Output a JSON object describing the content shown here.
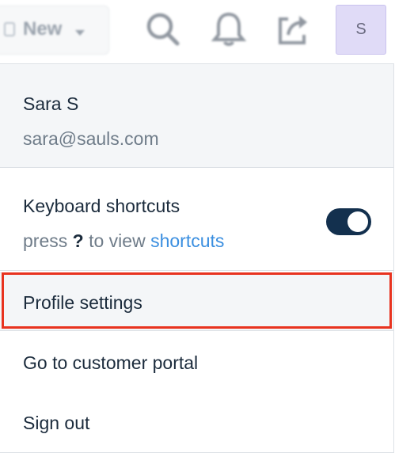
{
  "topbar": {
    "new_label": "New",
    "icons": [
      "search-icon",
      "bell-icon",
      "share-icon"
    ],
    "avatar_initial": "S",
    "avatar_bg": "#e0dbf7"
  },
  "user": {
    "name": "Sara S",
    "email": "sara@sauls.com"
  },
  "keyboard": {
    "title": "Keyboard shortcuts",
    "sub_prefix": "press",
    "sub_key": "?",
    "sub_middle": "to view",
    "sub_link": "shortcuts",
    "toggle_on": true,
    "toggle_color": "#13304e",
    "link_color": "#3b8fe0"
  },
  "menu": {
    "profile_settings": "Profile settings",
    "customer_portal": "Go to customer portal",
    "sign_out": "Sign out"
  },
  "highlight_color": "#e8331f"
}
